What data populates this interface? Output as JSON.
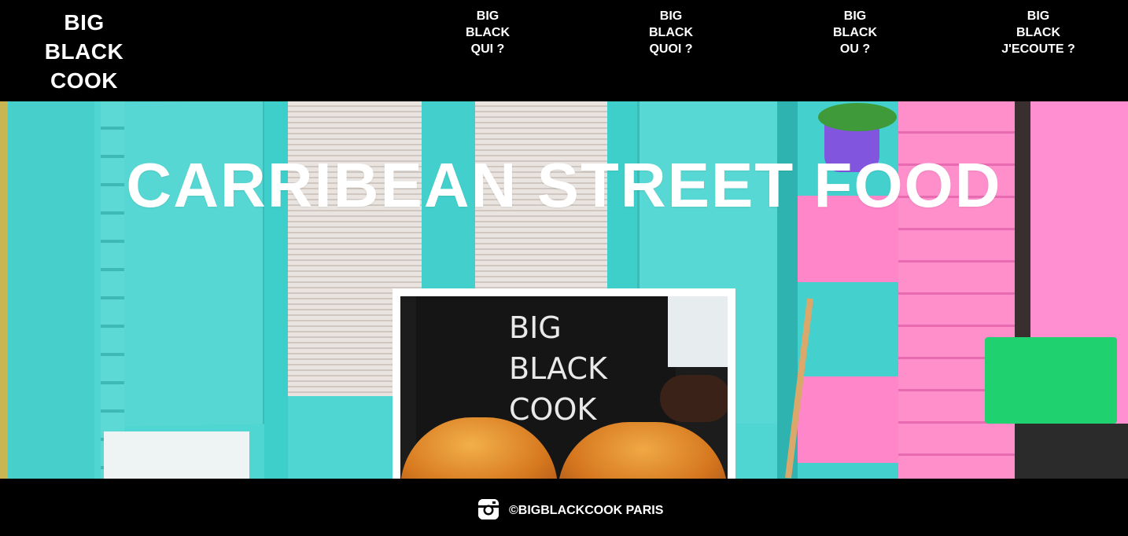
{
  "header": {
    "logo_lines": [
      "BIG",
      "BLACK",
      "COOK"
    ],
    "nav": [
      {
        "lines": [
          "BIG",
          "BLACK",
          "QUI ?"
        ]
      },
      {
        "lines": [
          "BIG",
          "BLACK",
          "QUOI ?"
        ]
      },
      {
        "lines": [
          "BIG",
          "BLACK",
          "OU ?"
        ]
      },
      {
        "lines": [
          "BIG",
          "BLACK",
          "J'ECOUTE ?"
        ]
      }
    ]
  },
  "hero": {
    "title": "CARRIBEAN STREET FOOD",
    "photo": {
      "shirt_lines": [
        "BIG",
        "BLACK",
        "COOK"
      ]
    }
  },
  "footer": {
    "social_icon": "instagram-icon",
    "copyright": "©BIGBLACKCOOK PARIS"
  },
  "colors": {
    "header_bg": "#000000",
    "turquoise": "#4fd6d2",
    "pink": "#ff7fc6",
    "text": "#ffffff"
  }
}
